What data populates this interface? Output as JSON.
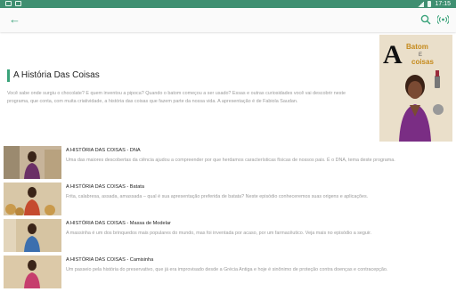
{
  "status_bar": {
    "time": "17:15"
  },
  "toolbar": {
    "back_icon": "arrow-back-icon",
    "search_icon": "search-icon",
    "cast_icon": "broadcast-icon"
  },
  "show": {
    "title": "A História Das Coisas",
    "description": "Você sabe onde surgiu o chocolate? E quem inventou a pipoca? Quando o batom começou a ser usado? Essas e outras curiosidades você vai descobrir neste programa, que conta, com muita criatividade, a história das coisas que fazem parte da nossa vida. A apresentação é de Fabiola Saudan.",
    "poster_text": [
      "Batom",
      "E",
      "coisas"
    ],
    "poster_letter": "A"
  },
  "episodes": [
    {
      "title": "A HISTÓRIA DAS COISAS - DNA",
      "description": "Uma das maiores descobertas da ciência ajudou a compreender por que herdamos características físicas de nossos pais. É o DNA, tema deste programa."
    },
    {
      "title": "A HISTÓRIA DAS COISAS - Batata",
      "description": "Frita, calabresa, assada, amassada – qual é sua apresentação preferida de batata? Neste episódio conheceremos suas origens e aplicações."
    },
    {
      "title": "A HISTÓRIA DAS COISAS - Massa de Modelar",
      "description": "A massinha é um dos brinquedos mais populares do mundo, mas foi inventada por acaso, por um farmacêutico. Veja mais no episódio a seguir."
    },
    {
      "title": "A HISTÓRIA DAS COISAS - Camisinha",
      "description": "Um passeio pela história do preservativo, que já era improvisado desde a Grécia Antiga e hoje é sinônimo de proteção contra doenças e contracepção."
    }
  ]
}
